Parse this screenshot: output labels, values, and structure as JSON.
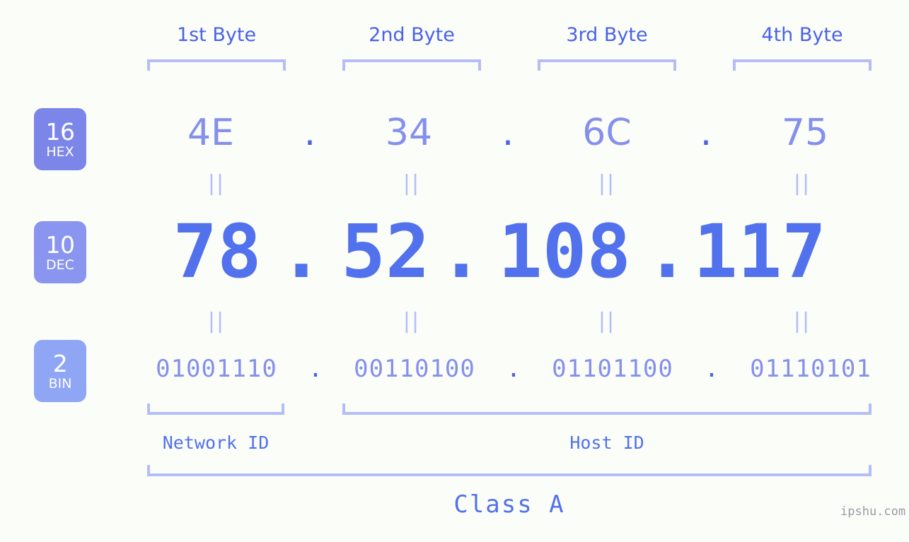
{
  "colors": {
    "background": "#fbfdf8",
    "accent_blue": "#4a62e8",
    "value_blue": "#5271ed",
    "muted_blue": "#8490ec",
    "bracket": "#b4bdf8",
    "badge_hex": "#7b86e8",
    "badge_dec": "#8a95ef",
    "badge_bin": "#8fa6f4",
    "watermark": "#9a9aa6"
  },
  "byte_headers": [
    {
      "label": "1st Byte"
    },
    {
      "label": "2nd Byte"
    },
    {
      "label": "3rd Byte"
    },
    {
      "label": "4th Byte"
    }
  ],
  "rows": [
    {
      "badge": {
        "number": "16",
        "name": "HEX"
      },
      "separator": ".",
      "values": [
        "4E",
        "34",
        "6C",
        "75"
      ]
    },
    {
      "badge": {
        "number": "10",
        "name": "DEC"
      },
      "separator": ".",
      "values": [
        "78",
        "52",
        "108",
        "117"
      ]
    },
    {
      "badge": {
        "number": "2",
        "name": "BIN"
      },
      "separator": ".",
      "values": [
        "01001110",
        "00110100",
        "01101100",
        "01110101"
      ]
    }
  ],
  "equals_symbol": "||",
  "sections": [
    {
      "label": "Network ID"
    },
    {
      "label": "Host ID"
    }
  ],
  "class": {
    "label": "Class A"
  },
  "watermark": {
    "text": "ipshu.com"
  }
}
